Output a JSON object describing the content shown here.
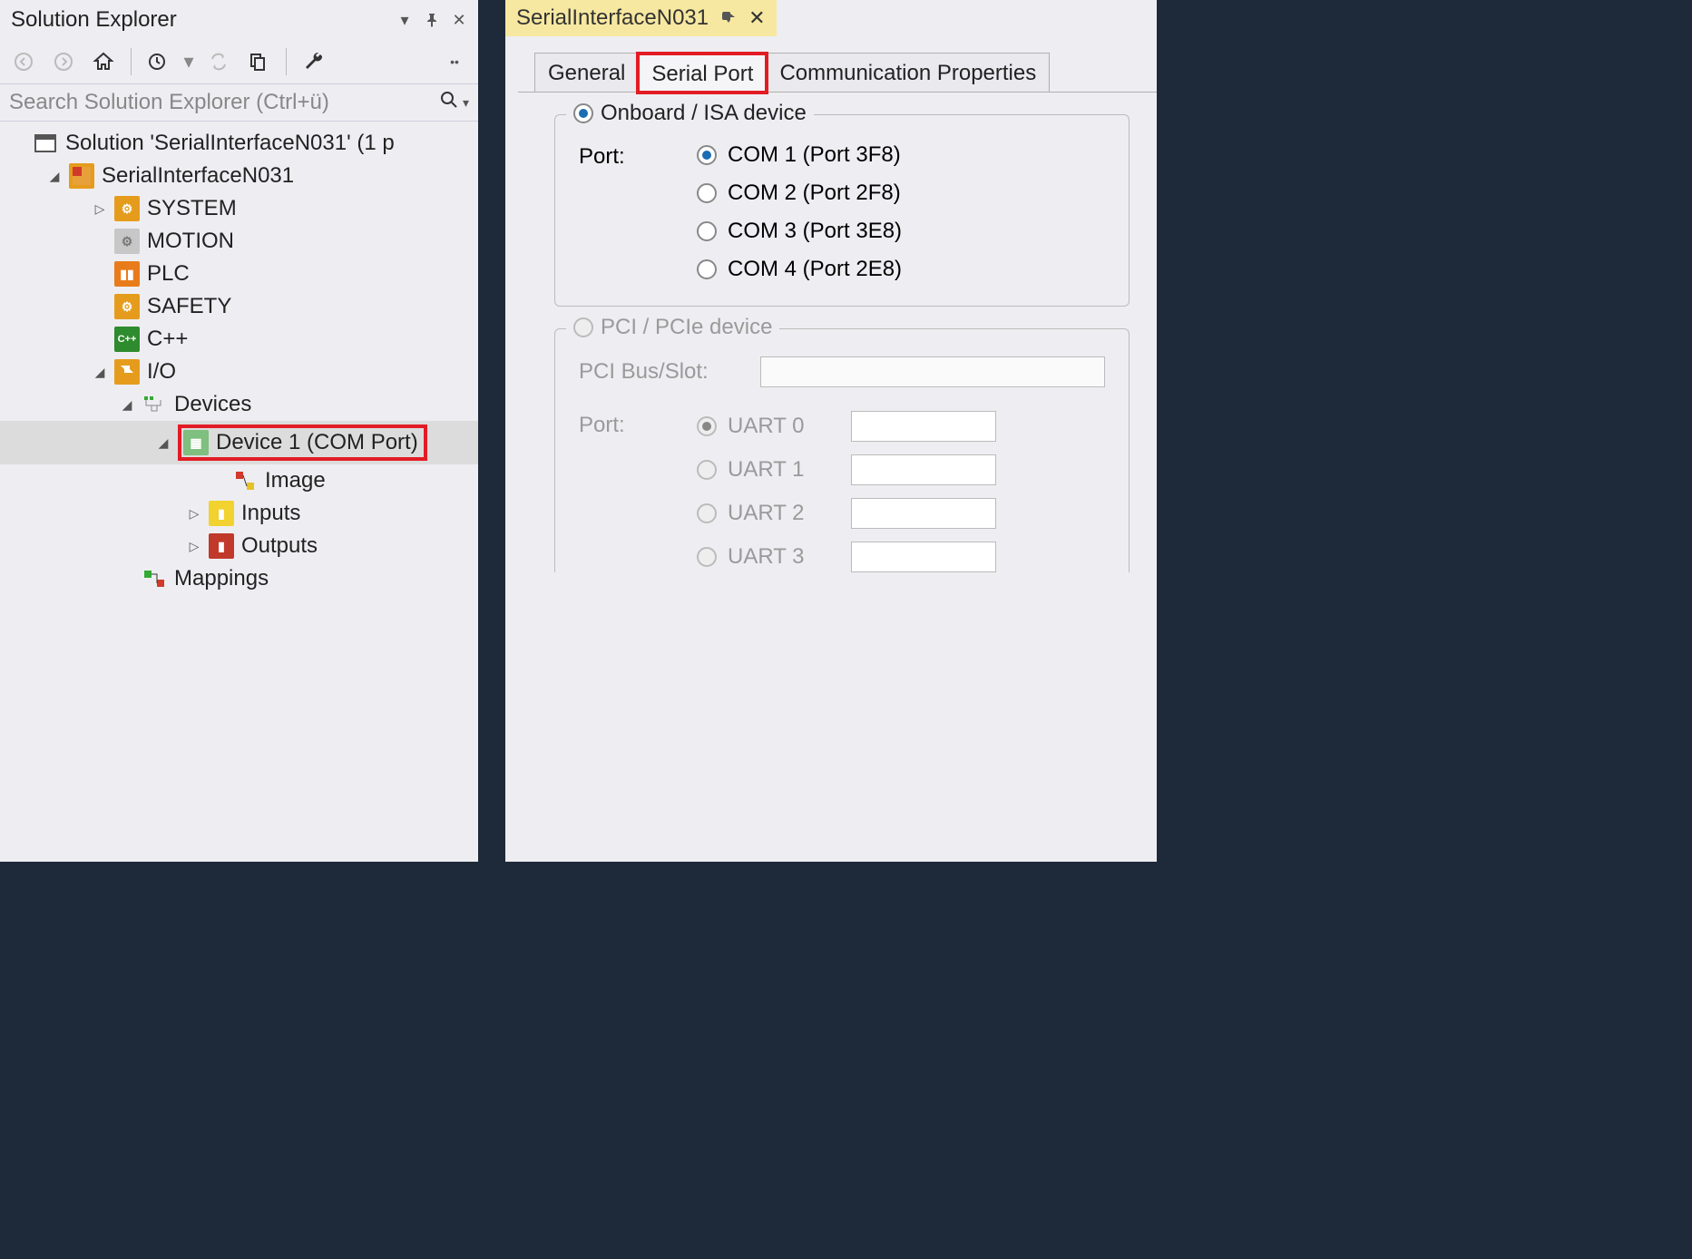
{
  "panel": {
    "title": "Solution Explorer"
  },
  "search": {
    "placeholder": "Search Solution Explorer (Ctrl+ü)"
  },
  "tree": {
    "solution": "Solution 'SerialInterfaceN031' (1 p",
    "project": "SerialInterfaceN031",
    "system": "SYSTEM",
    "motion": "MOTION",
    "plc": "PLC",
    "safety": "SAFETY",
    "cpp": "C++",
    "io": "I/O",
    "devices": "Devices",
    "device1": "Device 1 (COM Port)",
    "image": "Image",
    "inputs": "Inputs",
    "outputs": "Outputs",
    "mappings": "Mappings"
  },
  "doc": {
    "tab_title": "SerialInterfaceN031"
  },
  "tabs": {
    "general": "General",
    "serial_port": "Serial Port",
    "comm_props": "Communication Properties"
  },
  "onboard": {
    "title": "Onboard / ISA device",
    "port_label": "Port:",
    "com1": "COM 1 (Port 3F8)",
    "com2": "COM 2 (Port 2F8)",
    "com3": "COM 3 (Port 3E8)",
    "com4": "COM 4 (Port 2E8)"
  },
  "pci": {
    "title": "PCI / PCIe device",
    "busslot_label": "PCI Bus/Slot:",
    "port_label": "Port:",
    "uart0": "UART 0",
    "uart1": "UART 1",
    "uart2": "UART 2",
    "uart3": "UART 3"
  }
}
